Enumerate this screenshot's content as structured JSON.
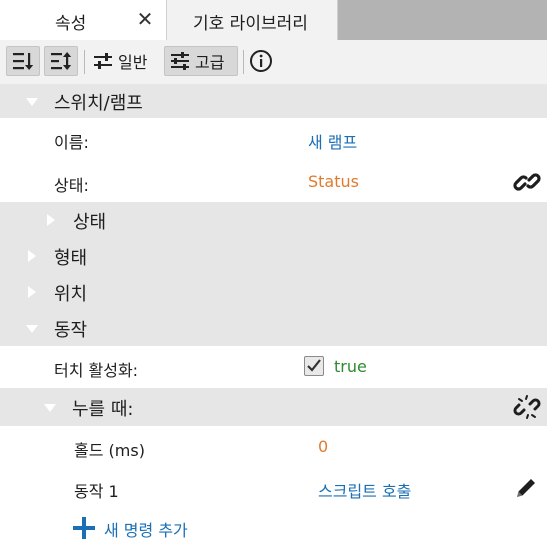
{
  "tabs": [
    {
      "label": "속성",
      "active": true
    },
    {
      "label": "기호 라이브러리",
      "active": false
    }
  ],
  "toolbar": {
    "general_label": "일반",
    "advanced_label": "고급"
  },
  "sections": {
    "switch_lamp": {
      "title": "스위치/램프",
      "name_label": "이름:",
      "name_value": "새 램프",
      "state_label": "상태:",
      "state_value": "Status",
      "state_group": "상태"
    },
    "shape": "형태",
    "position": "위치",
    "action": {
      "title": "동작",
      "touch_label": "터치 활성화:",
      "touch_value": "true",
      "on_press": {
        "title": "누를 때:",
        "hold_label": "홀드 (ms)",
        "hold_value": "0",
        "action1_label": "동작 1",
        "action1_value": "스크립트 호출"
      },
      "add_command": "새 명령 추가"
    }
  },
  "colors": {
    "link_blue": "#1a6fb5",
    "value_orange": "#e07b2e",
    "value_green": "#2e8b2e",
    "section_gray": "#e6e6e6"
  },
  "icons": [
    "close-icon",
    "sort-ascending-icon",
    "sort-descending-icon",
    "sliders-icon",
    "info-icon",
    "link-icon",
    "unlink-icon",
    "pencil-icon",
    "plus-icon",
    "checkmark-icon"
  ]
}
